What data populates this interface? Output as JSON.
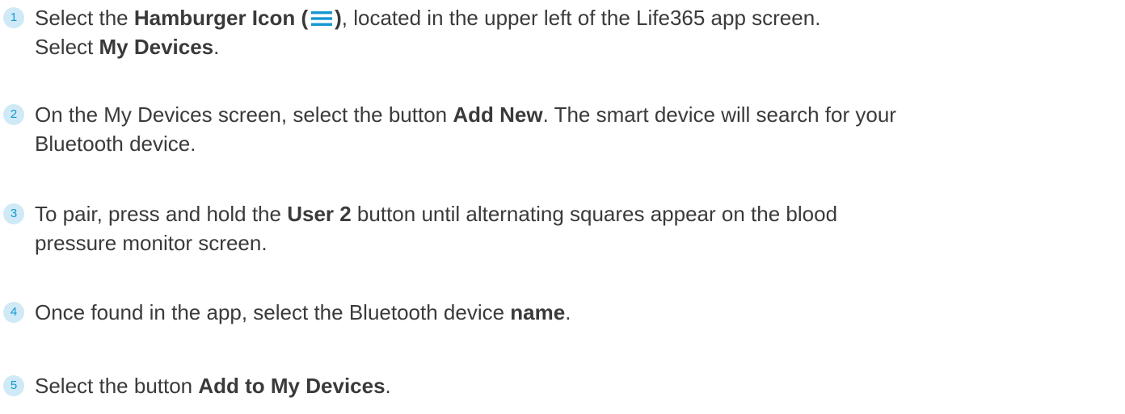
{
  "colors": {
    "accent": "#1597d1",
    "badge_bg": "#cfe9f6",
    "text": "#3a3a3a"
  },
  "steps": [
    {
      "number": "1",
      "line1": {
        "pre": "Select the ",
        "bold": "Hamburger Icon (",
        "icon": "hamburger-icon",
        "bold_close": ")",
        "post": ", located in the upper left of the Life365 app screen."
      },
      "line2": {
        "pre": "Select ",
        "bold": "My Devices",
        "post": "."
      }
    },
    {
      "number": "2",
      "line1": {
        "pre": "On the My Devices screen, select the button ",
        "bold": "Add New",
        "post": ". The smart device will search for your"
      },
      "line2": {
        "text": "Bluetooth device."
      }
    },
    {
      "number": "3",
      "line1": {
        "pre": "To pair, press and hold the ",
        "bold": "User 2",
        "post": " button until alternating squares appear on the blood"
      },
      "line2": {
        "text": "pressure monitor screen."
      }
    },
    {
      "number": "4",
      "line1": {
        "pre": "Once found in the app, select the Bluetooth device ",
        "bold": "name",
        "post": "."
      }
    },
    {
      "number": "5",
      "line1": {
        "pre": "Select the button ",
        "bold": "Add to My Devices",
        "post": "."
      }
    }
  ]
}
